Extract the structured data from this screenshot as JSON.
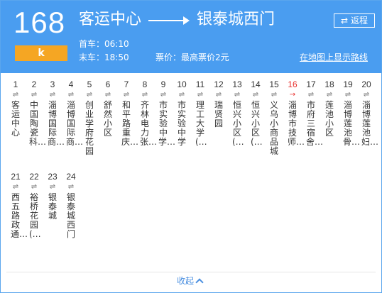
{
  "route": {
    "number": "168",
    "sub_label": "k",
    "origin": "客运中心",
    "destination": "银泰城西门",
    "return_label": "返程",
    "first_bus": "首车：06:10",
    "last_bus": "末车：18:50",
    "fare": "票价：最高票价2元",
    "map_link": "在地图上显示路线"
  },
  "stops": [
    {
      "num": "1",
      "dir": "⇌",
      "name": "客运中心"
    },
    {
      "num": "2",
      "dir": "⇌",
      "name": "中国陶瓷科…"
    },
    {
      "num": "3",
      "dir": "⇌",
      "name": "淄博国际商…"
    },
    {
      "num": "4",
      "dir": "⇌",
      "name": "淄博国际商…"
    },
    {
      "num": "5",
      "dir": "⇌",
      "name": "创业学府花园"
    },
    {
      "num": "6",
      "dir": "⇌",
      "name": "舒然小区"
    },
    {
      "num": "7",
      "dir": "⇌",
      "name": "和平路重庆…"
    },
    {
      "num": "8",
      "dir": "⇌",
      "name": "齐林电力张…"
    },
    {
      "num": "9",
      "dir": "⇌",
      "name": "市实验中学…"
    },
    {
      "num": "10",
      "dir": "⇌",
      "name": "市实验中学"
    },
    {
      "num": "11",
      "dir": "⇌",
      "name": "理工大学(…"
    },
    {
      "num": "12",
      "dir": "⇌",
      "name": "瑞贤园"
    },
    {
      "num": "13",
      "dir": "⇌",
      "name": "恒兴小区(…"
    },
    {
      "num": "14",
      "dir": "⇌",
      "name": "恒兴小区(…"
    },
    {
      "num": "15",
      "dir": "⇌",
      "name": "义乌小商品城"
    },
    {
      "num": "16",
      "dir": "→",
      "name": "淄博市技师…",
      "active": true
    },
    {
      "num": "17",
      "dir": "⇌",
      "name": "市府三宿舍…"
    },
    {
      "num": "18",
      "dir": "⇌",
      "name": "莲池小区"
    },
    {
      "num": "19",
      "dir": "⇌",
      "name": "淄博莲池骨…"
    },
    {
      "num": "20",
      "dir": "⇌",
      "name": "淄博莲池妇…"
    },
    {
      "num": "21",
      "dir": "⇌",
      "name": "西五路政通…"
    },
    {
      "num": "22",
      "dir": "⇌",
      "name": "裕桥花园(…"
    },
    {
      "num": "23",
      "dir": "⇌",
      "name": "银泰城"
    },
    {
      "num": "24",
      "dir": "⇌",
      "name": "银泰城西门"
    }
  ],
  "footer": {
    "collapse_label": "收起"
  },
  "colors": {
    "header_bg": "#4a9df0",
    "badge_bg": "#f5a623",
    "active_stop": "#e8312f",
    "link": "#4a8fe0"
  }
}
